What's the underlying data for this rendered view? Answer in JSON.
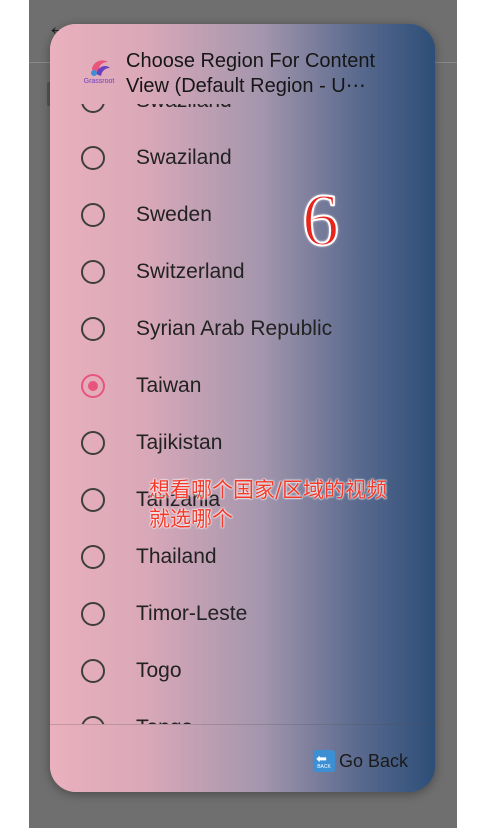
{
  "background": {
    "back_icon": "arrow-left-icon"
  },
  "dialog": {
    "title_line1": "Choose Region For Content",
    "title_line2": "View (Default Region - U⋯",
    "logo_text": "Grassroot",
    "selected": "Taiwan",
    "items": [
      {
        "label": "Swaziland",
        "checked": false
      },
      {
        "label": "Swaziland",
        "checked": false
      },
      {
        "label": "Sweden",
        "checked": false
      },
      {
        "label": "Switzerland",
        "checked": false
      },
      {
        "label": "Syrian Arab Republic",
        "checked": false
      },
      {
        "label": "Taiwan",
        "checked": true
      },
      {
        "label": "Tajikistan",
        "checked": false
      },
      {
        "label": "Tanzania",
        "checked": false
      },
      {
        "label": "Thailand",
        "checked": false
      },
      {
        "label": "Timor-Leste",
        "checked": false
      },
      {
        "label": "Togo",
        "checked": false
      },
      {
        "label": "Tonga",
        "checked": false
      }
    ],
    "footer": {
      "go_back_label": "Go Back",
      "back_icon_text": "BACK"
    }
  },
  "overlay": {
    "step_number": "6",
    "annotation_line1": "想看哪个国家/区域的视频",
    "annotation_line2": "就选哪个"
  },
  "colors": {
    "accent": "#e8557c",
    "annotation": "#f4382a",
    "go_back_icon": "#3d8fd4"
  }
}
